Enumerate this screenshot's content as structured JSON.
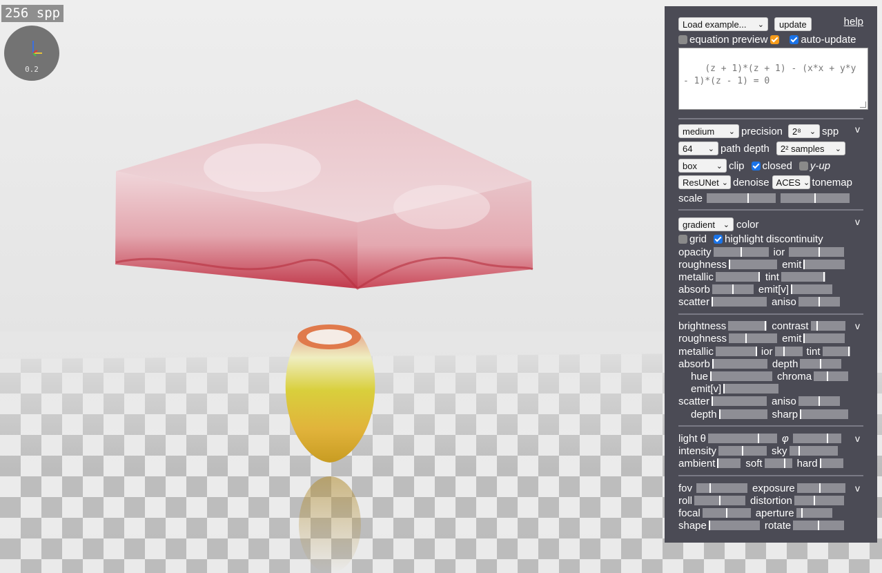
{
  "viewport": {
    "spp_badge": "256 spp",
    "gizmo_value": "0.2"
  },
  "panel": {
    "load_example": "Load example...",
    "update_button": "update",
    "help_link": "help",
    "equation_preview_label": "equation preview",
    "equation_preview_checked": false,
    "equation_preview_extra_checked": true,
    "auto_update_label": "auto-update",
    "auto_update_checked": true,
    "equation": "(z + 1)*(z + 1) - (x*x + y*y - 1)*(z - 1) = 0",
    "render": {
      "precision_value": "medium",
      "precision_label": "precision",
      "spp_value": "2⁸",
      "spp_label": "spp",
      "path_depth_value": "64",
      "path_depth_label": "path depth",
      "samples_value": "2² samples",
      "clip_value": "box",
      "clip_label": "clip",
      "closed_label": "closed",
      "closed_checked": true,
      "yup_label": "y-up",
      "yup_checked": false,
      "denoise_value": "ResUNet",
      "denoise_label": "denoise",
      "tonemap_value": "ACES",
      "tonemap_label": "tonemap",
      "scale_label": "scale",
      "scale_left": 0.6,
      "scale_right": 0.5,
      "toggle": "v"
    },
    "material": {
      "color_value": "gradient",
      "color_label": "color",
      "grid_label": "grid",
      "grid_checked": false,
      "highlight_label": "highlight discontinuity",
      "highlight_checked": true,
      "opacity_label": "opacity",
      "opacity": 0.5,
      "ior_label": "ior",
      "ior": 0.55,
      "roughness_label": "roughness",
      "roughness": 0.0,
      "emit_label": "emit",
      "emit": 0.0,
      "metallic_label": "metallic",
      "metallic": 1.0,
      "tint_label": "tint",
      "tint": 0.98,
      "absorb_label": "absorb",
      "absorb": 0.5,
      "emitv_label": "emit[v]",
      "emitv": 0.0,
      "scatter_label": "scatter",
      "scatter": 0.0,
      "aniso_label": "aniso",
      "aniso": 0.5,
      "toggle": "v"
    },
    "surface": {
      "brightness_label": "brightness",
      "brightness": 0.97,
      "contrast_label": "contrast",
      "contrast": 0.17,
      "roughness_label": "roughness",
      "roughness": 0.35,
      "emit_label": "emit",
      "emit": 0.0,
      "metallic_label": "metallic",
      "metallic": 1.0,
      "ior_label": "ior",
      "ior": 0.32,
      "tint_label": "tint",
      "tint": 0.98,
      "absorb_label": "absorb",
      "absorb": 0.0,
      "depth_label": "depth",
      "depth": 0.5,
      "hue_label": "hue",
      "hue": 0.0,
      "chroma_label": "chroma",
      "chroma": 0.4,
      "emitv_label": "emit[v]",
      "emitv": 0.0,
      "scatter_label": "scatter",
      "scatter": 0.0,
      "aniso_label": "aniso",
      "aniso": 0.5,
      "depth2_label": "depth",
      "depth2": 0.0,
      "sharp_label": "sharp",
      "sharp": 0.0,
      "toggle": "v"
    },
    "light": {
      "theta_label": "light θ",
      "theta": 0.73,
      "phi_label": "φ",
      "phi": 0.72,
      "intensity_label": "intensity",
      "intensity": 0.5,
      "sky_label": "sky",
      "sky": 0.2,
      "ambient_label": "ambient",
      "ambient": 0.0,
      "soft_label": "soft",
      "soft": 0.75,
      "hard_label": "hard",
      "hard": 0.0,
      "toggle": "v"
    },
    "camera": {
      "fov_label": "fov",
      "fov": 0.27,
      "exposure_label": "exposure",
      "exposure": 0.47,
      "roll_label": "roll",
      "roll": 0.5,
      "distortion_label": "distortion",
      "distortion": 0.4,
      "focal_label": "focal",
      "focal": 0.5,
      "aperture_label": "aperture",
      "aperture": 0.15,
      "shape_label": "shape",
      "shape": 0.0,
      "rotate_label": "rotate",
      "rotate": 0.5,
      "toggle": "v"
    }
  },
  "colors": {
    "panel_bg": "#4b4b55",
    "checkbox_blue": "#1a73e8",
    "checkbox_orange": "#f59b1a"
  }
}
